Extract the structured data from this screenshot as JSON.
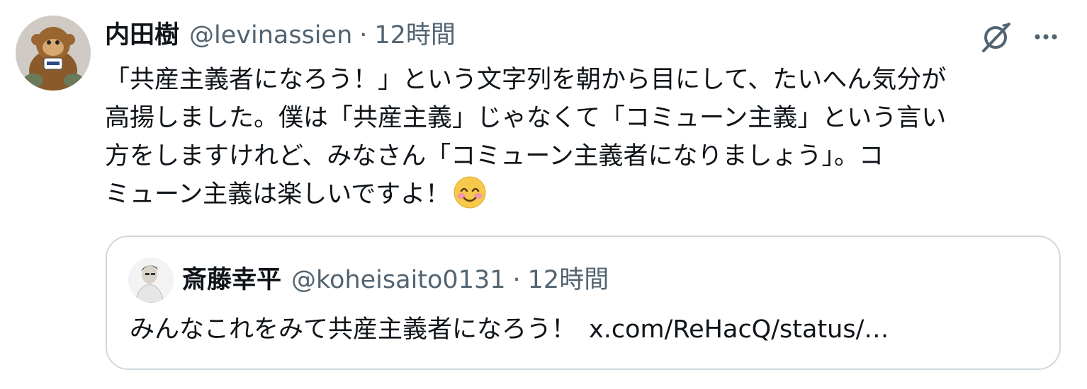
{
  "tweet": {
    "author_name": "内田樹",
    "handle": "@levinassien",
    "separator": "·",
    "time": "12時間",
    "lines": [
      "「共産主義者になろう！」という文字列を朝から目にして、たいへん気分が",
      "高揚しました。僕は「共産主義」じゃなくて「コミューン主義」という言い",
      "方をしますけれど、みなさん「コミューン主義者になりましょう」。コ",
      "ミューン主義は楽しいですよ！"
    ],
    "emoji": "smiling-face-with-smiling-eyes"
  },
  "quote": {
    "author_name": "斎藤幸平",
    "handle": "@koheisaito0131",
    "separator": "·",
    "time": "12時間",
    "text": "みんなこれをみて共産主義者になろう！",
    "link": "x.com/ReHacQ/status/…"
  },
  "icons": {
    "grok": "grok-icon",
    "more": "more-options-icon"
  },
  "colors": {
    "primary_text": "#0f1419",
    "secondary_text": "#536471",
    "border": "#cfd9de"
  }
}
